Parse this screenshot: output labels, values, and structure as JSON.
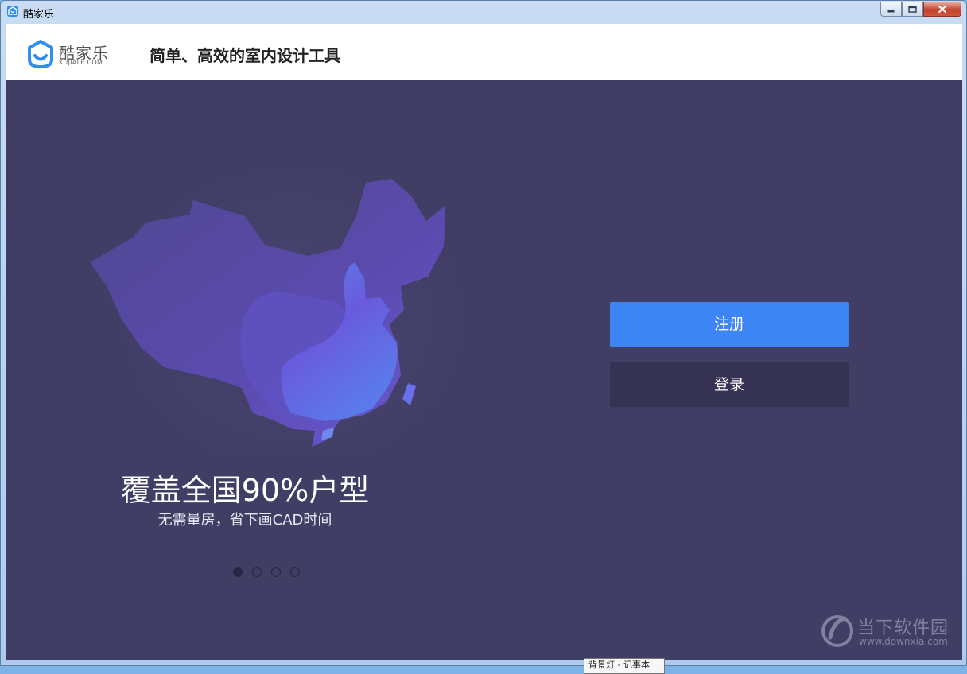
{
  "window": {
    "title": "酷家乐"
  },
  "header": {
    "logo_text": "酷家乐",
    "logo_sub": "KUJIALE.COM",
    "slogan": "简单、高效的室内设计工具"
  },
  "carousel": {
    "title": "覆盖全国90%户型",
    "subtitle": "无需量房，省下画CAD时间",
    "total_slides": 4,
    "active_slide": 1
  },
  "actions": {
    "register_label": "注册",
    "login_label": "登录"
  },
  "watermark": {
    "text": "当下软件园",
    "url": "www.downxia.com"
  },
  "tooltip": {
    "text": "背景灯 - 记事本"
  },
  "colors": {
    "accent": "#3d84f5",
    "background": "#413e66",
    "secondary_button": "#353254"
  }
}
